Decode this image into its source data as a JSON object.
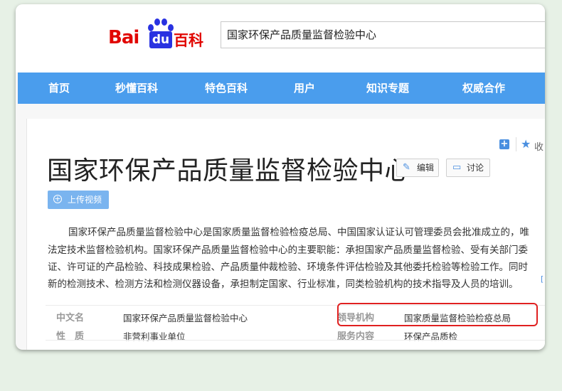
{
  "logo": {
    "bai": "Bai",
    "du": "du",
    "baike": "百科"
  },
  "search": {
    "value": "国家环保产品质量监督检验中心"
  },
  "nav": [
    "首页",
    "秒懂百科",
    "特色百科",
    "用户",
    "知识专题",
    "权威合作"
  ],
  "toolbar": {
    "add": "+",
    "fav": "收"
  },
  "article": {
    "title": "国家环保产品质量监督检验中心",
    "edit": "编辑",
    "discuss": "讨论",
    "upload_video": "上传视频",
    "paragraph": [
      "国家环保产品质量监督检验中心是国家质量监督检验检疫总局、中国国家认证认可管理委员会批准成立的，唯",
      "法定技术监督检验机构。国家环保产品质量监督检验中心的主要职能：承担国家产品质量监督检验、受有关部门委",
      "证、许可证的产品检验、科技成果检验、产品质量仲裁检验、环境条件评估检验及其他委托检验等检验工作。同时",
      "新的检测技术、检测方法和检测仪器设备，承担制定国家、行业标准，同类检验机构的技术指导及人员的培训。"
    ],
    "ref_mark": "["
  },
  "infobox": {
    "rows": [
      {
        "label1": "中文名",
        "value1": "国家环保产品质量监督检验中心",
        "label2": "领导机构",
        "value2": "国家质量监督检验检疫总局"
      },
      {
        "label1": "性　质",
        "value1": "非营利事业单位",
        "label2": "服务内容",
        "value2": "环保产品质检"
      }
    ]
  },
  "colors": {
    "nav": "#4a9ded",
    "highlight": "#e02020",
    "logo_red": "#e10601",
    "logo_blue": "#2932e1"
  }
}
